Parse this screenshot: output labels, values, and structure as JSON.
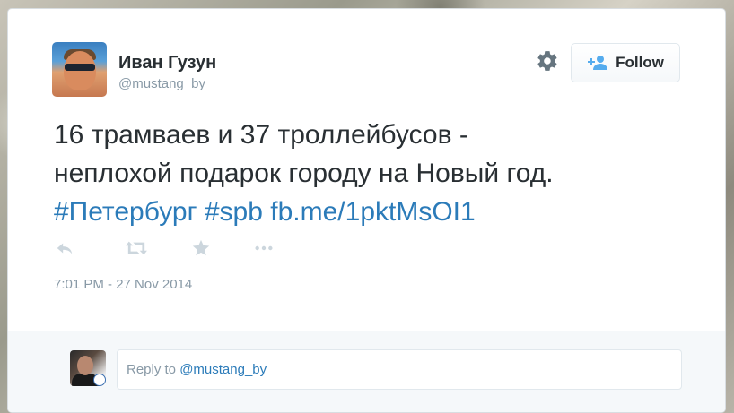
{
  "user": {
    "display_name": "Иван Гузун",
    "screen_name": "@mustang_by"
  },
  "header": {
    "settings_icon": "gear-icon",
    "follow_label": "Follow",
    "follow_icon": "add-user-icon"
  },
  "tweet": {
    "line1": "16 трамваев и 37 троллейбусов -",
    "line2": "неплохой подарок городу на Новый год.",
    "hashtag1": "#Петербург",
    "hashtag2": "#spb",
    "link": "fb.me/1pktMsOI1"
  },
  "actions": {
    "reply_icon": "reply-icon",
    "retweet_icon": "retweet-icon",
    "favorite_icon": "star-icon",
    "more_icon": "more-icon"
  },
  "timestamp": "7:01 PM - 27 Nov 2014",
  "reply": {
    "prefix": "Reply to ",
    "mention": "@mustang_by"
  },
  "colors": {
    "text": "#292f33",
    "muted": "#8899a6",
    "link": "#2b7bb9",
    "action_icon": "#ccd6dd",
    "reply_bar_bg": "#f5f8fa"
  }
}
